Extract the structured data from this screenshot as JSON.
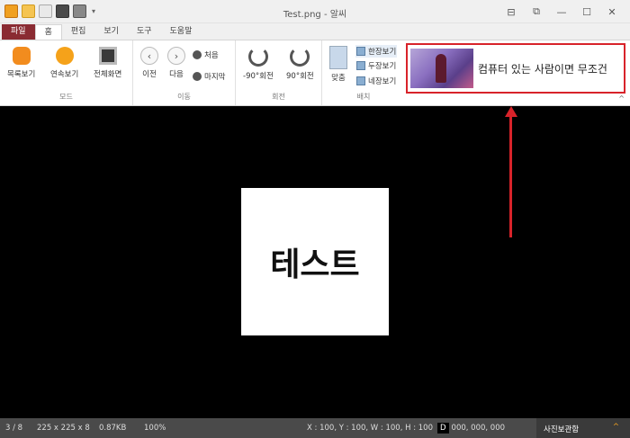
{
  "window": {
    "title": "Test.png - 알씨",
    "controls": [
      "⊟",
      "⧉",
      "—",
      "☐",
      "✕"
    ]
  },
  "tabs": [
    "파일",
    "홈",
    "편집",
    "보기",
    "도구",
    "도움말"
  ],
  "ribbon": {
    "mode": {
      "label": "모드",
      "buttons": [
        "목록보기",
        "연속보기",
        "전체화면"
      ]
    },
    "move": {
      "label": "이동",
      "prev": "이전",
      "next": "다음",
      "first": "처음",
      "last": "마지막"
    },
    "rotate": {
      "label": "회전",
      "left": "-90°회전",
      "right": "90°회전"
    },
    "arrange": {
      "label": "배치",
      "fit": "맞춤",
      "single": "한장보기",
      "double": "두장보기",
      "quad": "네장보기"
    },
    "ad_text": "컴퓨터 있는 사람이면 무조건"
  },
  "image": {
    "text": "테스트"
  },
  "status": {
    "page": "3 / 8",
    "dimensions": "225 x 225 x 8",
    "filesize": "0.87KB",
    "zoom": "100%",
    "coords": "X : 100, Y : 100, W : 100, H : 100",
    "color_label": "D",
    "color_value": "000, 000, 000",
    "viewer": "사진보관함",
    "chevron": "^"
  }
}
